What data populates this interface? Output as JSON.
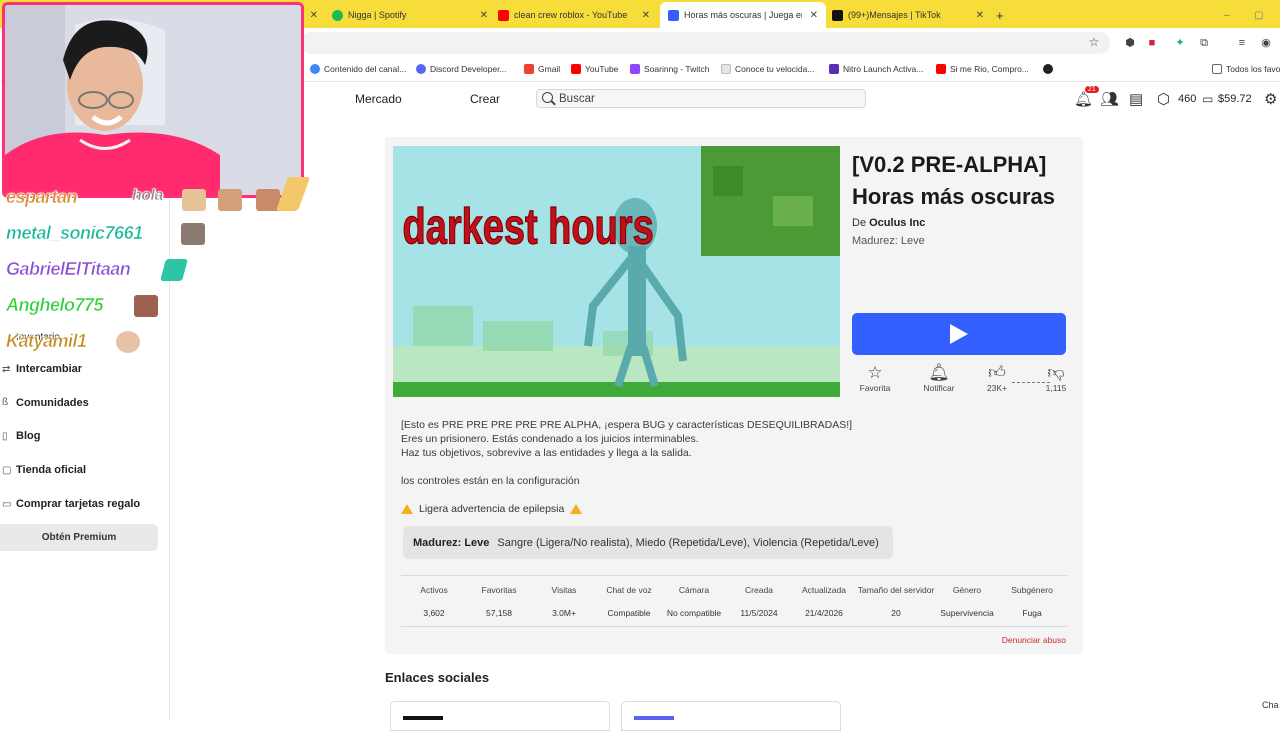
{
  "browser": {
    "tabs": [
      {
        "label": "Nigga | Spotify",
        "color": "#1db954"
      },
      {
        "label": "clean crew roblox - YouTube",
        "color": "#ff0000"
      },
      {
        "label": "Horas más oscuras | Juega en R",
        "color": "#335fff"
      },
      {
        "label": "(99+)Mensajes | TikTok",
        "color": "#111111"
      }
    ],
    "new_tab": "+",
    "bookmarks": [
      {
        "label": "Contenido del canal...",
        "color": "#4285f4"
      },
      {
        "label": "Discord Developer...",
        "color": "#5865f2"
      },
      {
        "label": "Gmail",
        "color": "#ea4335"
      },
      {
        "label": "YouTube",
        "color": "#ff0000"
      },
      {
        "label": "Soarinng - Twitch",
        "color": "#9146ff"
      },
      {
        "label": "Conoce tu velocida...",
        "color": "#e6e6e6"
      },
      {
        "label": "Nitro Launch Activa...",
        "color": "#5b2db0"
      },
      {
        "label": "Si me Rio, Compro...",
        "color": "#ff0000"
      }
    ],
    "all_bookmarks": "Todos los favo"
  },
  "header": {
    "nav": [
      "Mercado",
      "Crear"
    ],
    "search_placeholder": "Buscar",
    "notif_count": "21",
    "robux": "460",
    "balance": "$59.72"
  },
  "sidebar": {
    "items": [
      "Inventario",
      "Intercambiar",
      "Comunidades",
      "Blog",
      "Tienda oficial",
      "Comprar tarjetas regalo"
    ],
    "premium": "Obtén Premium"
  },
  "game": {
    "thumbnail_text": "darkest hours",
    "title": "[V0.2 PRE-ALPHA] Horas más oscuras",
    "creator_prefix": "De",
    "creator": "Oculus Inc",
    "maturity_top": "Madurez: Leve",
    "actions": [
      {
        "label": "Favorita",
        "value": ""
      },
      {
        "label": "Notificar",
        "value": ""
      },
      {
        "label": "",
        "value": "23K+"
      },
      {
        "label": "",
        "value": "1,115"
      }
    ],
    "description": [
      "[Esto es PRE PRE PRE PRE PRE ALPHA, ¡espera BUG y características DESEQUILIBRADAS!]",
      "Eres un prisionero. Estás condenado a los juicios interminables.",
      "Haz tus objetivos, sobrevive a las entidades y llega a la salida.",
      "",
      "los controles están en la configuración"
    ],
    "warning": "Ligera advertencia de epilepsia",
    "maturity_label": "Madurez: Leve",
    "maturity_detail": "Sangre (Ligera/No realista), Miedo (Repetida/Leve), Violencia (Repetida/Leve)",
    "stats": [
      {
        "label": "Activos",
        "value": "3,602"
      },
      {
        "label": "Favoritas",
        "value": "57,158"
      },
      {
        "label": "Visitas",
        "value": "3.0M+"
      },
      {
        "label": "Chat de voz",
        "value": "Compatible"
      },
      {
        "label": "Cámara",
        "value": "No compatible"
      },
      {
        "label": "Creada",
        "value": "11/5/2024"
      },
      {
        "label": "Actualizada",
        "value": "21/4/2026"
      },
      {
        "label": "Tamaño del servidor",
        "value": "20"
      },
      {
        "label": "Género",
        "value": "Supervivencia"
      },
      {
        "label": "Subgénero",
        "value": "Fuga"
      }
    ],
    "report": "Denunciar abuso",
    "social_title": "Enlaces sociales"
  },
  "overlay": {
    "chat": [
      {
        "name": "espartan",
        "text": "hola",
        "color": "#d98a2b"
      },
      {
        "name": "metal_sonic7661",
        "color": "#18b89a"
      },
      {
        "name": "GabrielElTitaan",
        "color": "#8a4fd8"
      },
      {
        "name": "Anghelo775",
        "color": "#2fcf3a"
      },
      {
        "name": "Katyamil1",
        "color": "#c98a20"
      }
    ]
  },
  "misc": {
    "edge_text": "Cha"
  }
}
